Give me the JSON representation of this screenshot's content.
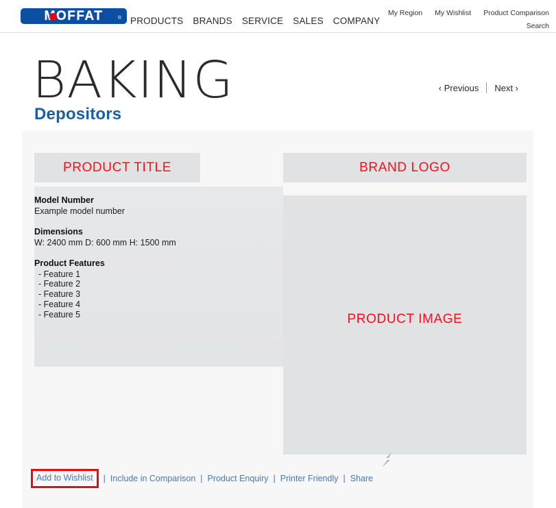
{
  "header": {
    "logo": {
      "text": "MOFFAT",
      "registered": "®",
      "brand_blue": "#0b4ea2",
      "brand_red": "#e3001b"
    },
    "main_nav": [
      "PRODUCTS",
      "BRANDS",
      "SERVICE",
      "SALES",
      "COMPANY"
    ],
    "util_nav_row1": [
      "My Region",
      "My Wishlist",
      "Product Comparison"
    ],
    "util_nav_row2": "Search"
  },
  "page": {
    "title": "BAKING",
    "subtitle": "Depositors",
    "pager": {
      "previous": "‹ Previous",
      "next": "Next ›"
    }
  },
  "product": {
    "title_placeholder": "PRODUCT TITLE",
    "brand_logo_placeholder": "BRAND LOGO",
    "image_placeholder": "PRODUCT IMAGE",
    "model_number_label": "Model Number",
    "model_number_value": "Example model number",
    "dimensions_label": "Dimensions",
    "dimensions_value": "W: 2400 mm D: 600 mm H: 1500 mm",
    "features_label": "Product Features",
    "features": [
      "- Feature 1",
      "- Feature 2",
      "- Feature 3",
      "- Feature 4",
      "- Feature 5"
    ]
  },
  "actions": {
    "add_to_wishlist": "Add to Wishlist",
    "include_in_comparison": "Include in Comparison",
    "product_enquiry": "Product Enquiry",
    "printer_friendly": "Printer Friendly",
    "share": "Share",
    "separator": "|",
    "highlight_color": "#f40707"
  },
  "colors": {
    "accent_red": "#fc0d1b",
    "link_blue": "#4a77b4",
    "heading_blue": "#1b5f9e",
    "placeholder_gray": "#e1e2e4",
    "panel_gray": "#f7f7f8"
  }
}
